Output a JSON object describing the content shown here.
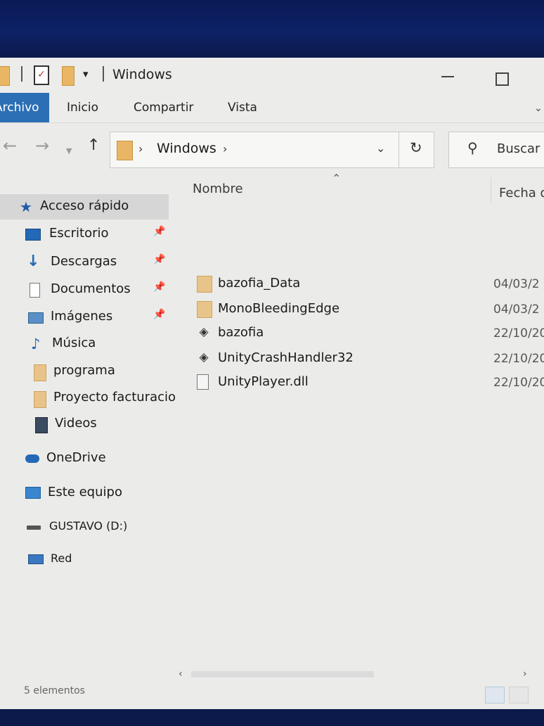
{
  "window": {
    "title": "Windows",
    "quick_access_menu_glyph": "▾"
  },
  "ribbon": {
    "tabs": [
      "Archivo",
      "Inicio",
      "Compartir",
      "Vista"
    ]
  },
  "address": {
    "current_folder": "Windows",
    "search_placeholder": "Buscar en Windows"
  },
  "navigation": {
    "items": [
      {
        "label": "Acceso rápido",
        "icon": "star-icon",
        "pinned": false,
        "selected": true
      },
      {
        "label": "Escritorio",
        "icon": "desktop-icon",
        "pinned": true,
        "selected": false
      },
      {
        "label": "Descargas",
        "icon": "download-arrow-icon",
        "pinned": true,
        "selected": false
      },
      {
        "label": "Documentos",
        "icon": "document-icon",
        "pinned": true,
        "selected": false
      },
      {
        "label": "Imágenes",
        "icon": "pictures-icon",
        "pinned": true,
        "selected": false
      },
      {
        "label": "Música",
        "icon": "music-note-icon",
        "pinned": false,
        "selected": false
      },
      {
        "label": "programa",
        "icon": "folder-icon",
        "pinned": false,
        "selected": false
      },
      {
        "label": "Proyecto facturacio",
        "icon": "folder-icon",
        "pinned": false,
        "selected": false
      },
      {
        "label": "Videos",
        "icon": "video-icon",
        "pinned": false,
        "selected": false
      },
      {
        "label": "OneDrive",
        "icon": "cloud-icon",
        "pinned": false,
        "selected": false
      },
      {
        "label": "Este equipo",
        "icon": "computer-icon",
        "pinned": false,
        "selected": false
      },
      {
        "label": "GUSTAVO (D:)",
        "icon": "drive-icon",
        "pinned": false,
        "selected": false
      },
      {
        "label": "Red",
        "icon": "network-icon",
        "pinned": false,
        "selected": false
      }
    ]
  },
  "file_list": {
    "columns": {
      "name": "Nombre",
      "date": "Fecha d"
    },
    "files": [
      {
        "name": "bazofia_Data",
        "type": "folder",
        "date": "04/03/2"
      },
      {
        "name": "MonoBleedingEdge",
        "type": "folder",
        "date": "04/03/2"
      },
      {
        "name": "bazofia",
        "type": "unity-exe",
        "date": "22/10/20"
      },
      {
        "name": "UnityCrashHandler32",
        "type": "unity-exe",
        "date": "22/10/20"
      },
      {
        "name": "UnityPlayer.dll",
        "type": "dll",
        "date": "22/10/20"
      }
    ]
  },
  "status": {
    "item_count": "5 elementos"
  },
  "colors": {
    "file_tab": "#2c6fb5",
    "folder": "#e8c48a",
    "selection": "#d6d6d6"
  }
}
